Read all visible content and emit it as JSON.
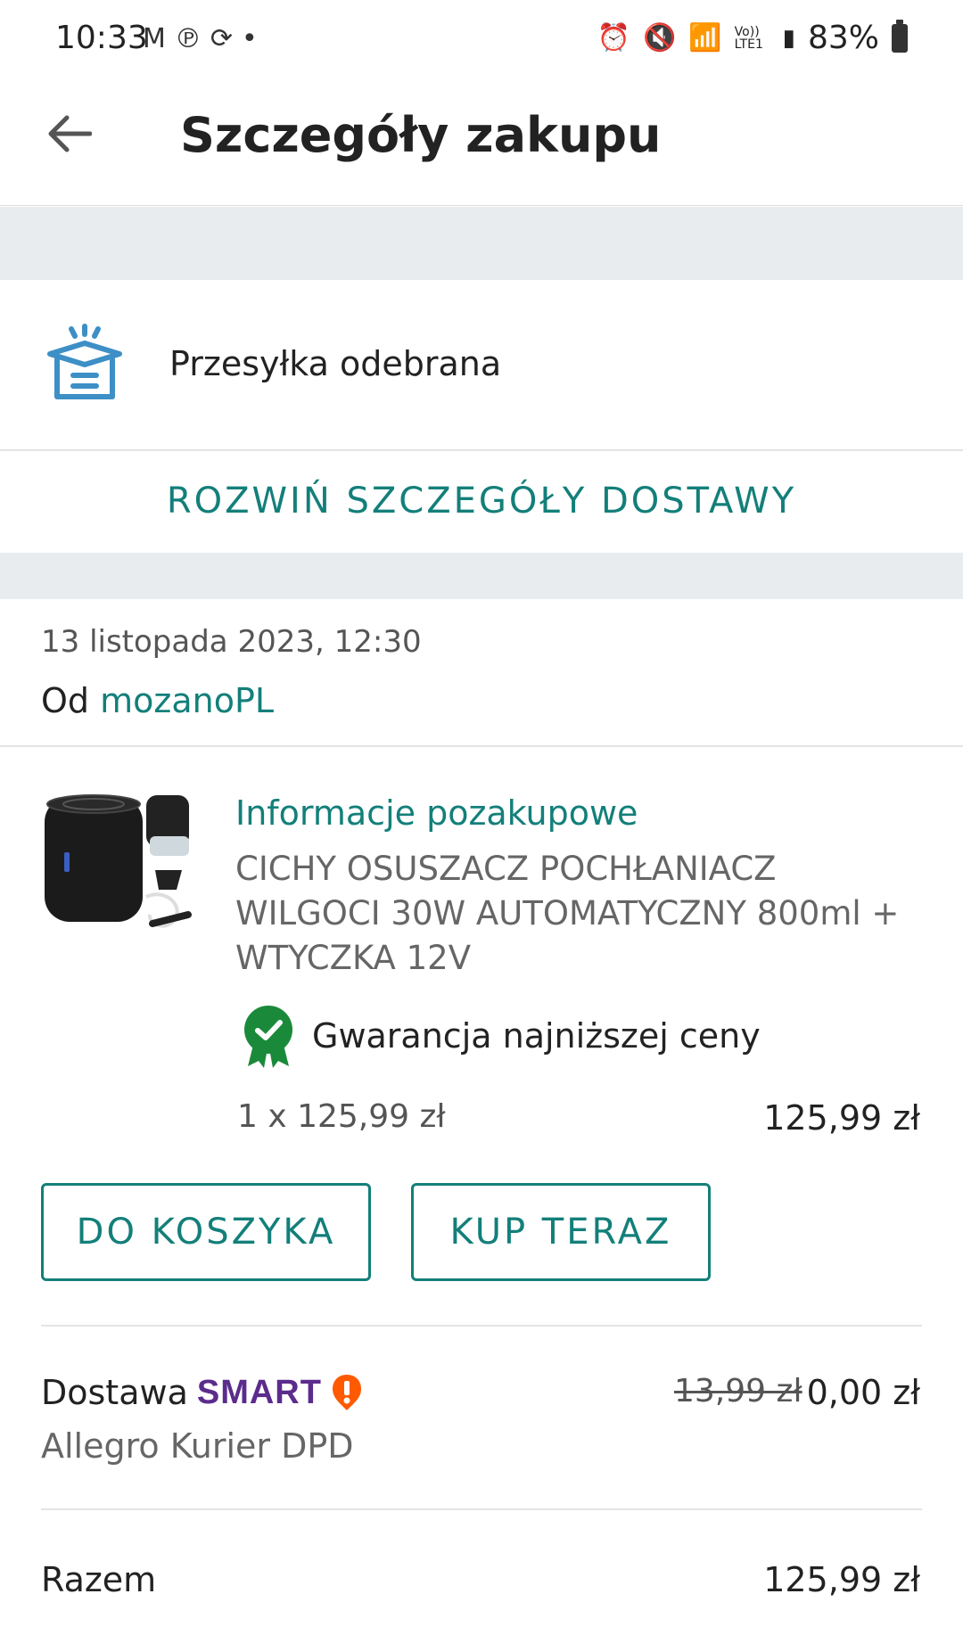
{
  "status_bar": {
    "time": "10:33",
    "left_icons": [
      "gmail-icon",
      "pinterest-icon",
      "sync-icon",
      "dot-icon"
    ],
    "right_icons": [
      "alarm-icon",
      "mute-icon",
      "wifi-icon",
      "volte-icon",
      "signal-icon"
    ],
    "volte_label": "Vo)) LTE1",
    "battery": "83%"
  },
  "header": {
    "title": "Szczegóły zakupu",
    "back_icon": "arrow-left-icon"
  },
  "delivery": {
    "icon": "package-open-icon",
    "status": "Przesyłka odebrana",
    "expand_label": "ROZWIŃ SZCZEGÓŁY DOSTAWY"
  },
  "order": {
    "date": "13 listopada 2023, 12:30",
    "seller_prefix": "Od",
    "seller_name": "mozanoPL"
  },
  "item": {
    "info_link": "Informacje pozakupowe",
    "name": "CICHY OSUSZACZ POCHŁANIACZ WILGOCI 30W AUTOMATYCZNY 800ml + WTYCZKA 12V",
    "guarantee": "Gwarancja najniższej ceny",
    "qty_price": "1 x 125,99 zł",
    "total": "125,99 zł",
    "add_to_cart": "DO KOSZYKA",
    "buy_now": "KUP TERAZ"
  },
  "shipping": {
    "label": "Dostawa",
    "smart_badge": "SMART",
    "courier": "Allegro Kurier DPD",
    "old_price": "13,99 zł",
    "price": "0,00 zł"
  },
  "summary": {
    "label": "Razem",
    "value": "125,99 zł"
  },
  "colors": {
    "accent": "#137f7a",
    "smart": "#5b2c8c",
    "smart_icon": "#ff5a00",
    "guarantee": "#1a8a3a",
    "band": "#e9ecee",
    "box_icon": "#3d8fc6"
  }
}
